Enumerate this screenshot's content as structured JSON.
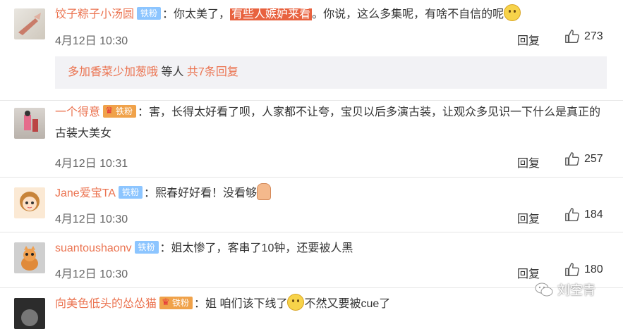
{
  "comments": [
    {
      "username": "饺子粽子小汤圆",
      "badge": "铁粉",
      "text_before": "：你太美了，",
      "highlight": "有些人嫉妒来看",
      "text_after": "。你说，这么多集呢，有啥不自信的呢",
      "timestamp": "4月12日 10:30",
      "reply_label": "回复",
      "likes": "273",
      "sub_replies": {
        "user": "多加香菜少加葱哦",
        "middle": " 等人 ",
        "count_text": "共7条回复"
      }
    },
    {
      "username": "一个得意",
      "badge": "铁粉",
      "text": "：害，长得太好看了呗，人家都不让夸，宝贝以后多演古装，让观众多见识一下什么是真正的古装大美女",
      "timestamp": "4月12日 10:31",
      "reply_label": "回复",
      "likes": "257"
    },
    {
      "username": "Jane爱宝TA",
      "badge": "铁粉",
      "text": "：熙春好好看！没看够",
      "timestamp": "4月12日 10:30",
      "reply_label": "回复",
      "likes": "184"
    },
    {
      "username": "suantoushaonv",
      "badge": "铁粉",
      "text": "：姐太惨了，客串了10钟，还要被人黑",
      "timestamp": "4月12日 10:30",
      "reply_label": "回复",
      "likes": "180"
    },
    {
      "username": "向美色低头的怂怂猫",
      "badge": "铁粉",
      "text_before": "：姐   咱们该下线了",
      "text_after": "不然又要被cue了"
    }
  ],
  "watermark": "刘空青",
  "colors": {
    "username": "#eb7350",
    "badge": "#8cc5ff",
    "highlight": "#e8623f"
  }
}
